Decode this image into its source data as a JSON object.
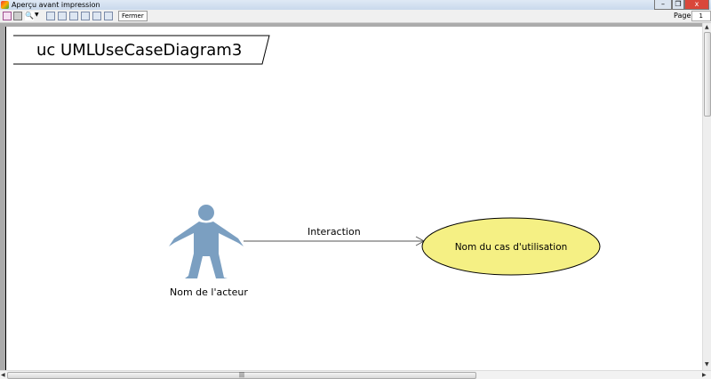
{
  "window": {
    "title": "Aperçu avant impression",
    "minimize": "–",
    "restore": "❐",
    "close": "x"
  },
  "toolbar": {
    "close_label": "Fermer",
    "page_label": "Page",
    "page_value": "1"
  },
  "diagram": {
    "frame_title": "uc UMLUseCaseDiagram3",
    "actor_name": "Nom de l'acteur",
    "association_label": "Interaction",
    "use_case_name": "Nom du cas d'utilisation",
    "colors": {
      "actor": "#7b9fc1",
      "use_case_fill": "#f5f084"
    }
  }
}
